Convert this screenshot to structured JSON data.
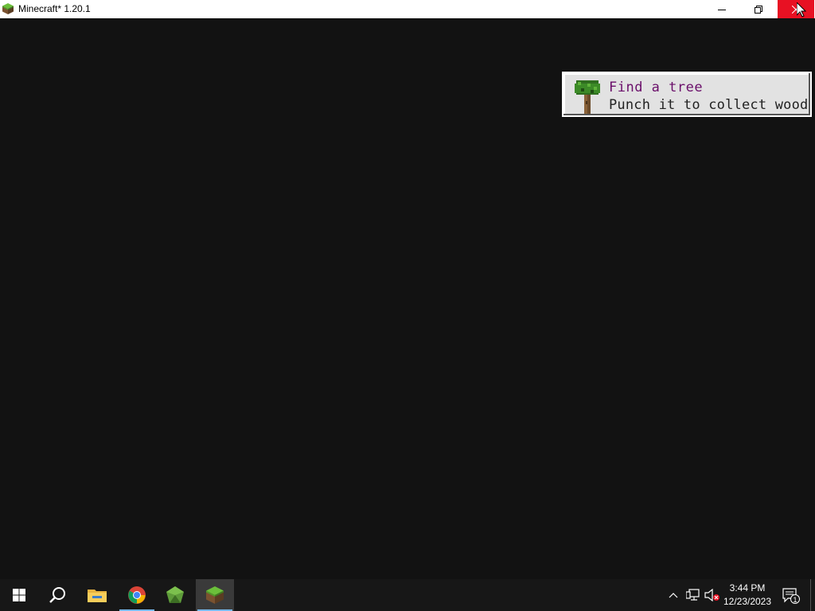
{
  "window": {
    "title": "Minecraft* 1.20.1",
    "buttons": [
      "minimize",
      "restore",
      "close"
    ]
  },
  "toast": {
    "title": "Find a tree",
    "description": "Punch it to collect wood",
    "icon": "tree-icon",
    "title_color": "#6a0e6a"
  },
  "taskbar": {
    "apps": [
      "start",
      "search",
      "file-explorer",
      "chrome",
      "emerald-launcher",
      "minecraft"
    ],
    "clock": {
      "time": "3:44 PM",
      "date": "12/23/2023"
    },
    "notification_count": "1"
  },
  "colors": {
    "game_background": "#121212",
    "close_hover": "#e81123",
    "taskbar": "#171717"
  }
}
